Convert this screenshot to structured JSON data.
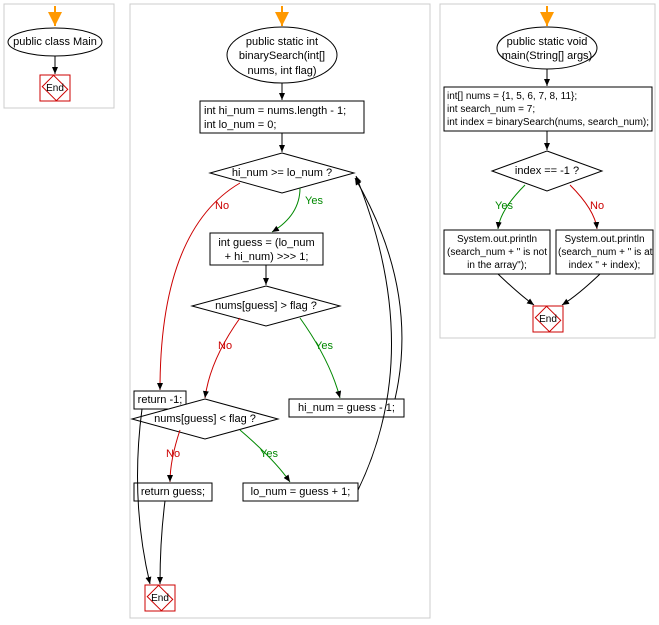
{
  "chart_data": {
    "type": "flowchart",
    "subgraphs": [
      {
        "name": "class",
        "entry_arrow": true,
        "nodes": [
          {
            "id": "class_start",
            "type": "start_ellipse",
            "text": "public class Main"
          },
          {
            "id": "class_end",
            "type": "end",
            "text": "End"
          }
        ],
        "edges": [
          {
            "from": "class_start",
            "to": "class_end"
          }
        ]
      },
      {
        "name": "binarySearch",
        "entry_arrow": true,
        "nodes": [
          {
            "id": "bs_start",
            "type": "start_ellipse",
            "text": "public static int\nbinarySearch(int[]\nnums, int flag)"
          },
          {
            "id": "bs_init",
            "type": "process",
            "text": "int hi_num = nums.length - 1;\nint lo_num = 0;"
          },
          {
            "id": "bs_cond1",
            "type": "decision",
            "text": "hi_num >= lo_num ?"
          },
          {
            "id": "bs_guess",
            "type": "process",
            "text": "int guess = (lo_num\n+ hi_num) >>> 1;"
          },
          {
            "id": "bs_ret_m1",
            "type": "process",
            "text": "return -1;"
          },
          {
            "id": "bs_cond2",
            "type": "decision",
            "text": "nums[guess] > flag ?"
          },
          {
            "id": "bs_hi",
            "type": "process",
            "text": "hi_num = guess - 1;"
          },
          {
            "id": "bs_cond3",
            "type": "decision",
            "text": "nums[guess] < flag ?"
          },
          {
            "id": "bs_lo",
            "type": "process",
            "text": "lo_num = guess + 1;"
          },
          {
            "id": "bs_ret_guess",
            "type": "process",
            "text": "return guess;"
          },
          {
            "id": "bs_end",
            "type": "end",
            "text": "End"
          }
        ],
        "edges": [
          {
            "from": "bs_start",
            "to": "bs_init"
          },
          {
            "from": "bs_init",
            "to": "bs_cond1"
          },
          {
            "from": "bs_cond1",
            "to": "bs_guess",
            "label": "Yes"
          },
          {
            "from": "bs_cond1",
            "to": "bs_ret_m1",
            "label": "No"
          },
          {
            "from": "bs_guess",
            "to": "bs_cond2"
          },
          {
            "from": "bs_cond2",
            "to": "bs_hi",
            "label": "Yes"
          },
          {
            "from": "bs_cond2",
            "to": "bs_cond3",
            "label": "No"
          },
          {
            "from": "bs_cond3",
            "to": "bs_lo",
            "label": "Yes"
          },
          {
            "from": "bs_cond3",
            "to": "bs_ret_guess",
            "label": "No"
          },
          {
            "from": "bs_hi",
            "to": "bs_cond1",
            "back": true
          },
          {
            "from": "bs_lo",
            "to": "bs_cond1",
            "back": true
          },
          {
            "from": "bs_ret_m1",
            "to": "bs_end"
          },
          {
            "from": "bs_ret_guess",
            "to": "bs_end"
          }
        ]
      },
      {
        "name": "main",
        "entry_arrow": true,
        "nodes": [
          {
            "id": "m_start",
            "type": "start_ellipse",
            "text": "public static void\nmain(String[] args)"
          },
          {
            "id": "m_init",
            "type": "process",
            "text": "int[] nums = {1, 5, 6, 7, 8, 11};\nint search_num = 7;\nint index = binarySearch(nums, search_num);"
          },
          {
            "id": "m_cond",
            "type": "decision",
            "text": "index == -1 ?"
          },
          {
            "id": "m_print_not",
            "type": "process",
            "text": "System.out.println\n(search_num + \" is not\nin the array\");"
          },
          {
            "id": "m_print_at",
            "type": "process",
            "text": "System.out.println\n(search_num + \" is at\nindex \" + index);"
          },
          {
            "id": "m_end",
            "type": "end",
            "text": "End"
          }
        ],
        "edges": [
          {
            "from": "m_start",
            "to": "m_init"
          },
          {
            "from": "m_init",
            "to": "m_cond"
          },
          {
            "from": "m_cond",
            "to": "m_print_not",
            "label": "Yes"
          },
          {
            "from": "m_cond",
            "to": "m_print_at",
            "label": "No"
          },
          {
            "from": "m_print_not",
            "to": "m_end"
          },
          {
            "from": "m_print_at",
            "to": "m_end"
          }
        ]
      }
    ]
  },
  "labels": {
    "class_start": "public class Main",
    "class_end": "End",
    "bs_start": "public static int\nbinarySearch(int[]\nnums, int flag)",
    "bs_init": "int hi_num = nums.length - 1;\nint lo_num = 0;",
    "bs_cond1": "hi_num >= lo_num ?",
    "bs_guess": "int guess = (lo_num\n+ hi_num) >>> 1;",
    "bs_ret_m1": "return -1;",
    "bs_cond2": "nums[guess] > flag ?",
    "bs_hi": "hi_num = guess - 1;",
    "bs_cond3": "nums[guess] < flag ?",
    "bs_lo": "lo_num = guess + 1;",
    "bs_ret_guess": "return guess;",
    "bs_end": "End",
    "m_start": "public static void\nmain(String[] args)",
    "m_init": "int[] nums = {1, 5, 6, 7, 8, 11};\nint search_num = 7;\nint index = binarySearch(nums, search_num);",
    "m_cond": "index == -1 ?",
    "m_print_not": "System.out.println\n(search_num + \" is not\nin the array\");",
    "m_print_at": "System.out.println\n(search_num + \" is at\nindex \" + index);",
    "m_end": "End",
    "yes": "Yes",
    "no": "No"
  }
}
